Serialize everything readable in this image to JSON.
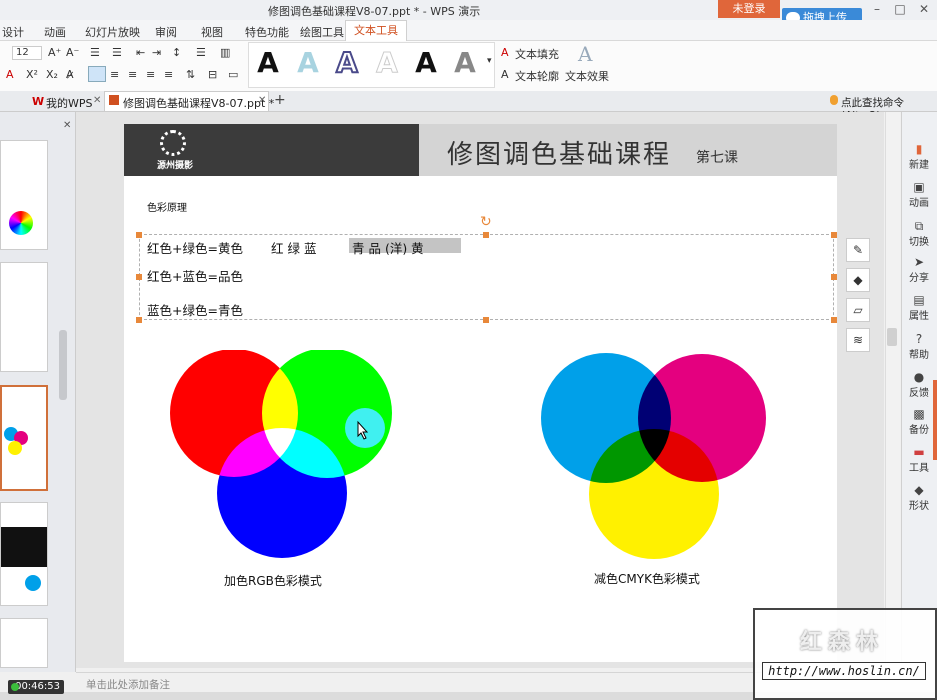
{
  "titlebar": {
    "doc_title": "修图调色基础课程V8-07.ppt * - WPS 演示",
    "login": "未登录",
    "upload": "拖拽上传"
  },
  "menu": [
    "设计",
    "动画",
    "幻灯片放映",
    "审阅",
    "视图",
    "特色功能",
    "绘图工具",
    "文本工具"
  ],
  "ribbon": {
    "font_size": "12",
    "text_fill": "文本填充",
    "text_outline": "文本轮廓",
    "text_effect": "文本效果"
  },
  "doctabs": {
    "home": "我的WPS",
    "active": "修图调色基础课程V8-07.ppt *",
    "search": "点此查找命令 (Alt+Q)"
  },
  "slide": {
    "course_title": "修图调色基础课程",
    "lesson": "第七课",
    "logo_text": "源州摄影",
    "section_label": "色彩原理",
    "line1": "红色+绿色=黄色",
    "rgb_chars": "红  绿  蓝",
    "cmy_chars": "青   品 (洋)   黄",
    "line2": "红色+蓝色=品色",
    "line3": "蓝色+绿色=青色",
    "rgb_caption": "加色RGB色彩模式",
    "cmyk_caption": "减色CMYK色彩模式"
  },
  "rightbar": [
    "新建",
    "动画",
    "切换",
    "分享",
    "属性",
    "帮助",
    "反馈",
    "备份",
    "工具",
    "形状"
  ],
  "notes_placeholder": "单击此处添加备注",
  "timer": "00:46:53",
  "watermark": {
    "title": "红森林",
    "url": "http://www.hoslin.cn/"
  },
  "colors": {
    "accent": "#e0663a",
    "upload": "#3a8ad8",
    "red": "#ff0000",
    "green": "#00ff00",
    "blue": "#0000ff",
    "cyan": "#00a0e9",
    "magenta": "#e4007f",
    "yellow": "#fff100"
  }
}
